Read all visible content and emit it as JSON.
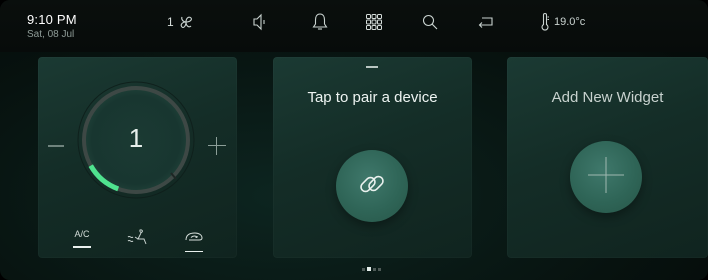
{
  "status_bar": {
    "time": "9:10 PM",
    "date": "Sat, 08 Jul",
    "fan_level": "1",
    "temperature": "19.0°c",
    "icons": [
      "fan-icon",
      "speaker-icon",
      "bell-icon",
      "apps-grid-icon",
      "search-icon",
      "return-icon",
      "thermometer-icon"
    ]
  },
  "climate_card": {
    "dial_value": "1",
    "dial_level_fraction": 0.15,
    "ac_label": "A/C",
    "seat_icon": "seat-airflow-icon",
    "recirc_icon": "recirculation-icon"
  },
  "pair_card": {
    "title": "Tap to pair a device",
    "icon": "link-icon"
  },
  "widget_card": {
    "title": "Add New Widget",
    "icon": "plus-icon"
  },
  "pagination": {
    "current_page": 2,
    "total_pages": 4
  },
  "colors": {
    "accent_green": "#43e08f",
    "card_bg": "#1a3832",
    "button_teal": "#336b5d"
  }
}
